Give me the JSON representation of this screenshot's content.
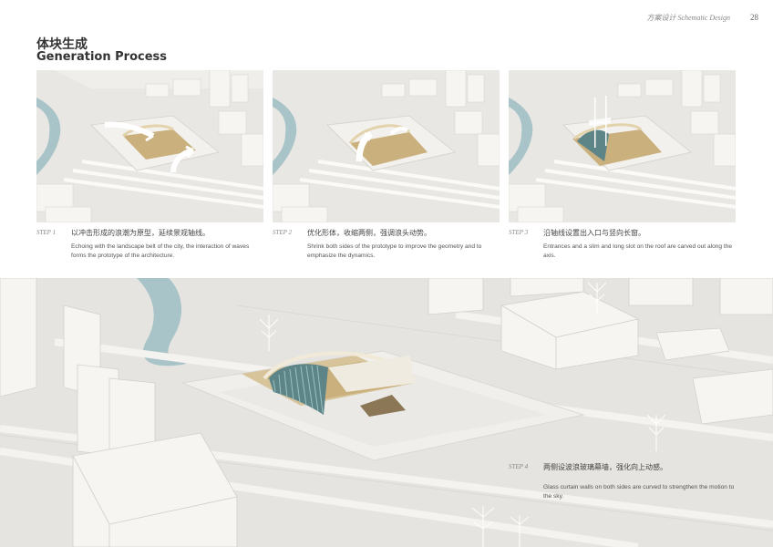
{
  "header": {
    "section": "方案设计   Schematic Design",
    "page_number": "28"
  },
  "title": {
    "cn": "体块生成",
    "en": "Generation Process"
  },
  "steps": [
    {
      "label": "STEP 1",
      "cn": "以冲击形成的浪潮为原型，延续景观轴线。",
      "en": "Echoing with the landscape belt of the city, the interaction of waves forms the prototype of the architecture."
    },
    {
      "label": "STEP 2",
      "cn": "优化形体，收缩两侧，强调浪头动势。",
      "en": "Shrink both sides of the prototype to improve the geometry and to emphasize the dynamics."
    },
    {
      "label": "STEP 3",
      "cn": "沿轴线设置出入口与竖向长窗。",
      "en": "Entrances and a slim and long slot on the roof are carved out along the axis."
    },
    {
      "label": "STEP 4",
      "cn": "两侧设波浪玻璃幕墙，强化向上动感。",
      "en": "Glass curtain walls on both sides are curved to strengthen the motion to the sky."
    }
  ],
  "colors": {
    "background": "#ffffff",
    "model_base": "#e9e7e3",
    "building_white": "#f6f5f2",
    "river": "#a9c4c8",
    "gold_interior": "#c9b07c",
    "glass": "#5d8588",
    "text_dark": "#333333",
    "text_caption": "#888888"
  }
}
